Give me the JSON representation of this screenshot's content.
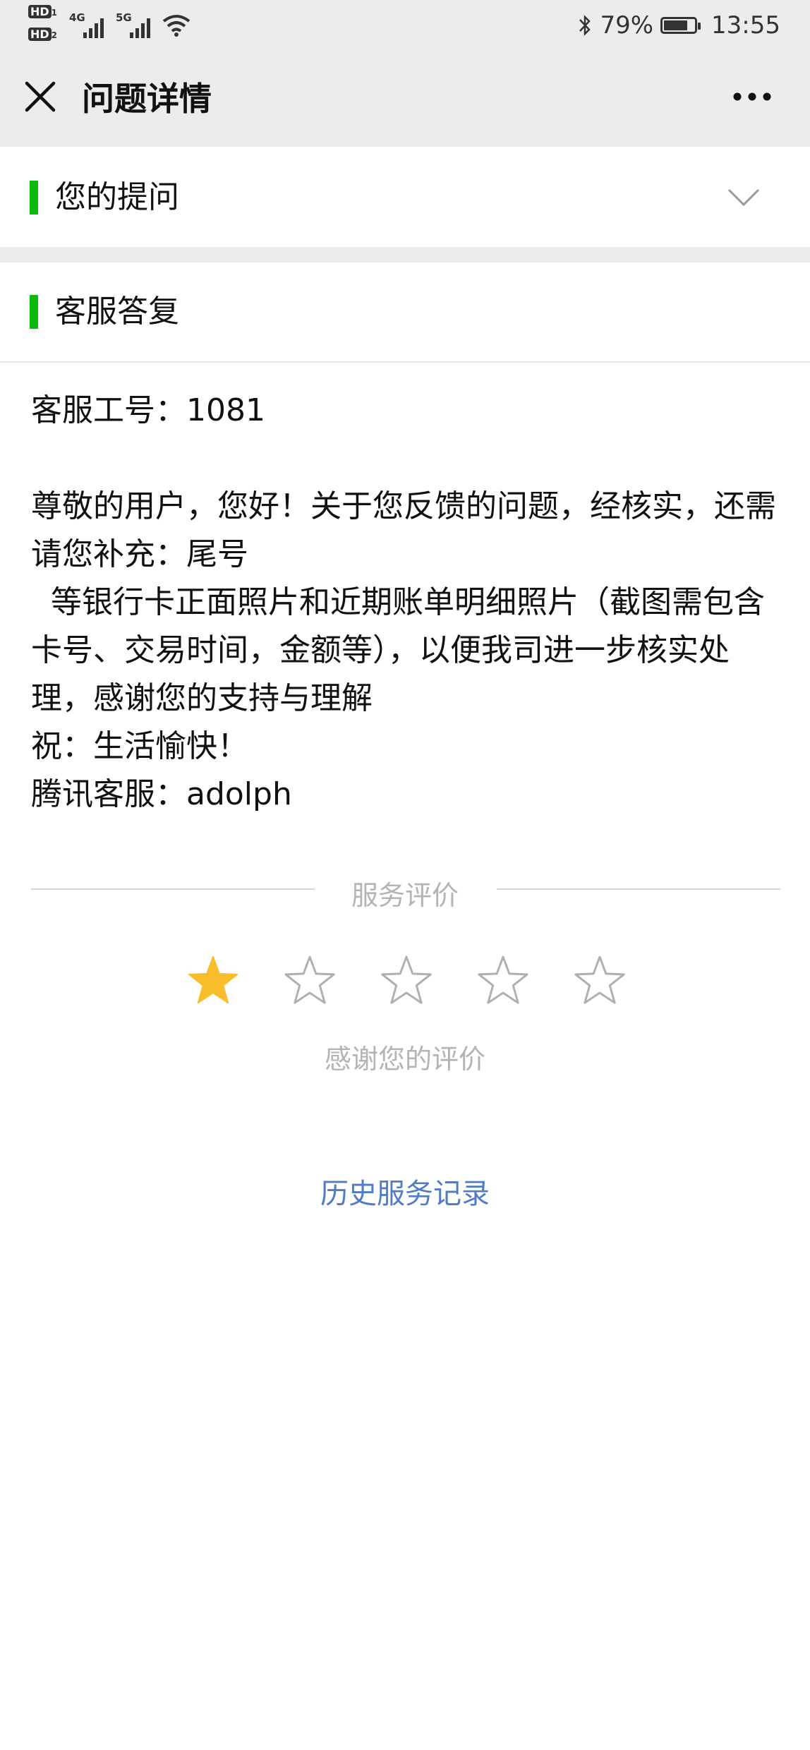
{
  "status_bar": {
    "sim1": "HD",
    "sim1_index": "1",
    "sim2": "HD",
    "sim2_index": "2",
    "network1": "4G",
    "network2": "5G",
    "battery_percent": "79%",
    "battery_level": 0.79,
    "time": "13:55"
  },
  "nav": {
    "title": "问题详情"
  },
  "question_section": {
    "title": "您的提问"
  },
  "reply_section": {
    "title": "客服答复"
  },
  "reply": {
    "agent_id": "客服工号：1081",
    "line1": "尊敬的用户，您好！关于您反馈的问题，经核实，还需请您补充：尾号",
    "line2": "  等银行卡正面照片和近期账单明细照片（截图需包含卡号、交易时间，金额等），以便我司进一步核实处理，感谢您的支持与理解",
    "greeting": "祝：生活愉快！",
    "signature": "腾讯客服：adolph"
  },
  "rating": {
    "label": "服务评价",
    "stars_total": 5,
    "stars_selected": 1,
    "thanks": "感谢您的评价",
    "active_color": "#f7bd2a",
    "inactive_color": "#b0b0b0"
  },
  "history_link": "历史服务记录",
  "colors": {
    "accent_bar": "#09bb07",
    "link": "#4f7cc3"
  }
}
